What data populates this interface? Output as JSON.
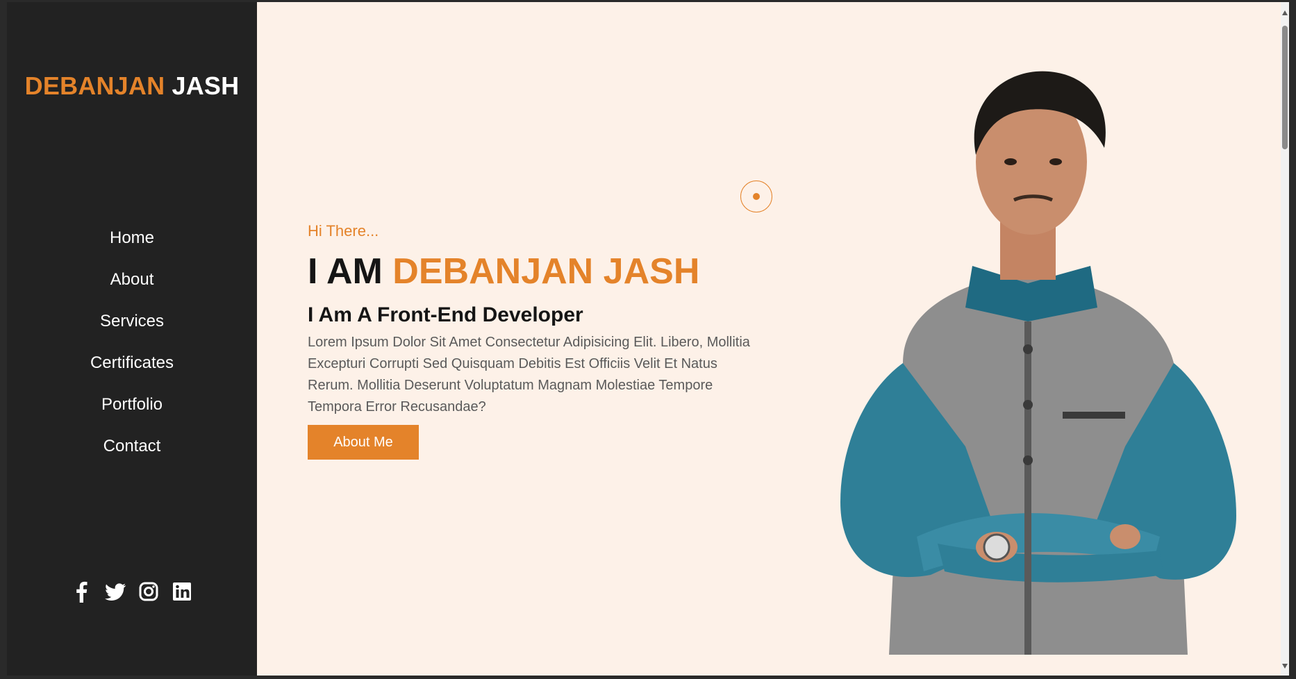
{
  "sidebar": {
    "logo": {
      "first": "DEBANJAN",
      "second": "JASH"
    },
    "nav": [
      "Home",
      "About",
      "Services",
      "Certificates",
      "Portfolio",
      "Contact"
    ],
    "social": [
      "facebook-icon",
      "twitter-icon",
      "instagram-icon",
      "linkedin-icon"
    ]
  },
  "hero": {
    "greeting": "Hi There...",
    "headline_prefix": "I AM",
    "headline_name": "DEBANJAN JASH",
    "subheading": "I Am A Front-End Developer",
    "description": "Lorem Ipsum Dolor Sit Amet Consectetur Adipisicing Elit. Libero, Mollitia Excepturi Corrupti Sed Quisquam Debitis Est Officiis Velit Et Natus Rerum. Mollitia Deserunt Voluptatum Magnam Molestiae Tempore Tempora Error Recusandae?",
    "cta_label": "About Me"
  },
  "colors": {
    "accent": "#e4832a",
    "sidebar_bg": "#222222",
    "page_bg": "#fdf1e8"
  }
}
